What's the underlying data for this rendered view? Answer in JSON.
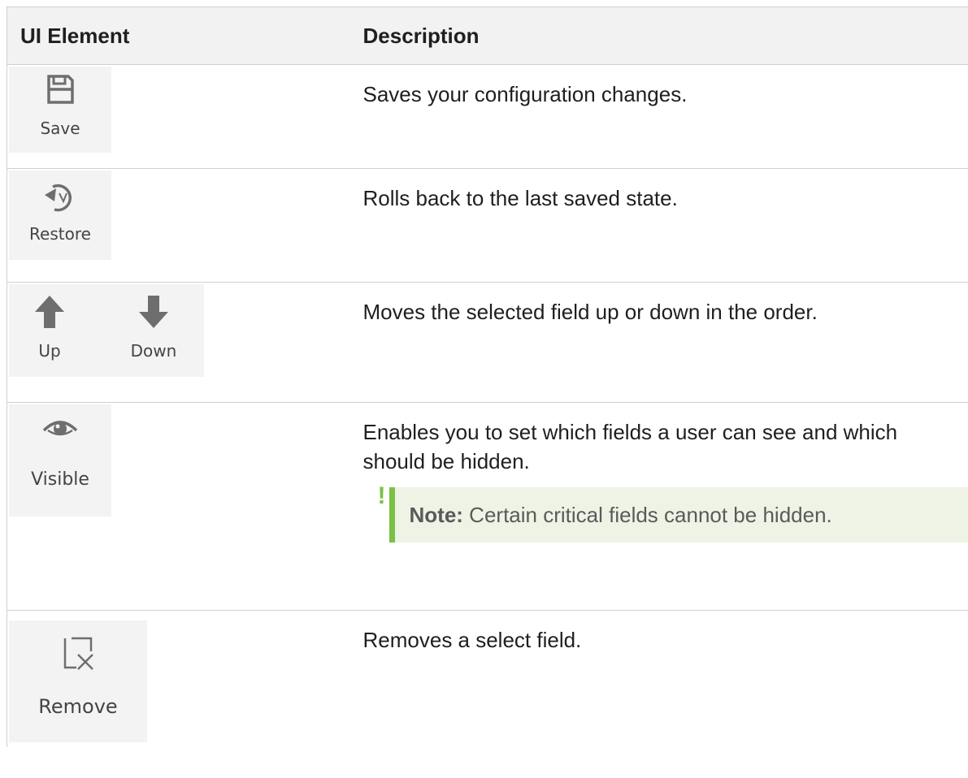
{
  "table": {
    "header": {
      "col_ui": "UI Element",
      "col_desc": "Description"
    },
    "rows": [
      {
        "buttons": [
          {
            "label": "Save",
            "icon": "save-icon"
          }
        ],
        "description": "Saves your configuration changes."
      },
      {
        "buttons": [
          {
            "label": "Restore",
            "icon": "restore-icon"
          }
        ],
        "description": "Rolls back to the last saved state."
      },
      {
        "buttons": [
          {
            "label": "Up",
            "icon": "arrow-up-icon"
          },
          {
            "label": "Down",
            "icon": "arrow-down-icon"
          }
        ],
        "description": "Moves the selected field up or down in the order."
      },
      {
        "buttons": [
          {
            "label": "Visible",
            "icon": "eye-icon"
          }
        ],
        "description": "Enables you to set which fields a user can see and which should be hidden.",
        "note": {
          "label": "Note:",
          "text": "Certain critical fields cannot be hidden.",
          "marker": "!"
        }
      },
      {
        "buttons": [
          {
            "label": "Remove",
            "icon": "remove-icon"
          }
        ],
        "description": "Removes a select field."
      }
    ]
  },
  "colors": {
    "header_bg": "#f2f2f2",
    "border": "#d0d0d0",
    "tile_bg": "#f3f3f3",
    "icon": "#6e6e6e",
    "note_bg": "#eef3e6",
    "note_accent": "#7ac143"
  }
}
